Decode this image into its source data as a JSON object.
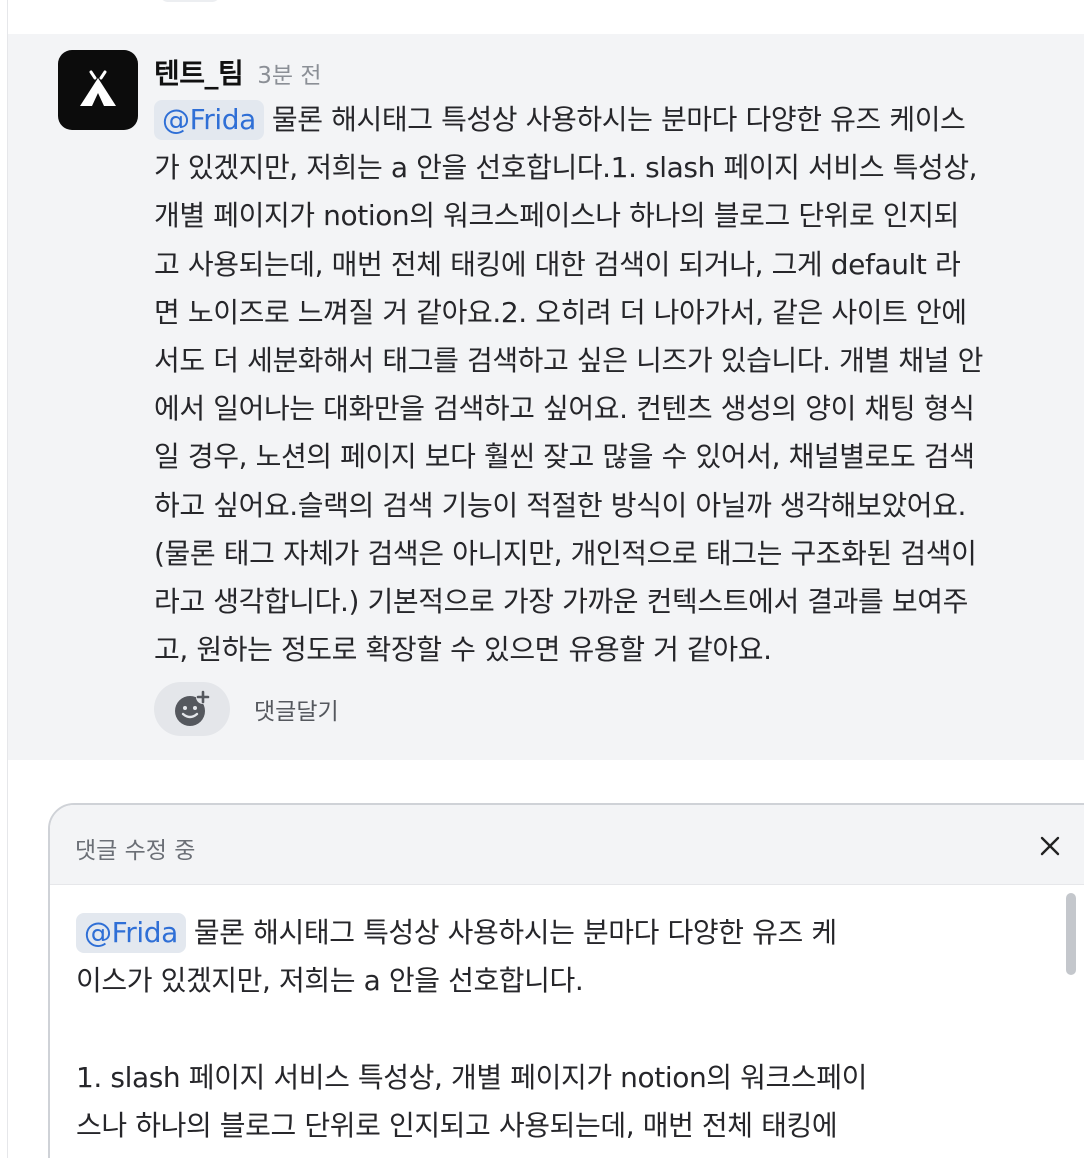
{
  "message": {
    "author": "텐트_팀",
    "time": "3분 전",
    "mention": "@Frida",
    "lines": [
      "물론 해시태그 특성상 사용하시는 분마다 다양한 유즈 케이스",
      "가 있겠지만, 저희는 a 안을 선호합니다.1. slash 페이지 서비스 특성상,",
      "개별 페이지가 notion의 워크스페이스나 하나의 블로그 단위로 인지되",
      "고 사용되는데, 매번 전체 태킹에 대한 검색이 되거나, 그게 default 라",
      "면 노이즈로 느껴질 거 같아요.2. 오히려 더 나아가서, 같은 사이트 안에",
      "서도 더 세분화해서 태그를 검색하고 싶은 니즈가 있습니다. 개별 채널 안",
      "에서 일어나는 대화만을 검색하고 싶어요. 컨텐츠 생성의 양이 채팅 형식",
      "일 경우, 노션의 페이지 보다 훨씬 잦고 많을 수 있어서, 채널별로도 검색",
      "하고 싶어요.슬랙의 검색 기능이 적절한 방식이 아닐까 생각해보았어요.",
      "(물론 태그 자체가 검색은 아니지만, 개인적으로 태그는 구조화된 검색이",
      "라고 생각합니다.) 기본적으로 가장 가까운 컨텍스트에서 결과를 보여주",
      "고, 원하는 정도로 확장할 수 있으면 유용할 거 같아요."
    ],
    "comment_label": "댓글달기"
  },
  "editor": {
    "title": "댓글 수정 중",
    "mention": "@Frida",
    "lines": [
      "물론 해시태그 특성상 사용하시는 분마다 다양한 유즈 케",
      "이스가 있겠지만, 저희는 a 안을 선호합니다.",
      "",
      "1. slash 페이지 서비스 특성상, 개별 페이지가 notion의 워크스페이",
      "스나 하나의 블로그 단위로 인지되고 사용되는데, 매번 전체 태킹에"
    ]
  },
  "icons": {
    "avatar": "tent-icon",
    "reaction": "add-reaction-icon",
    "close": "close-icon"
  },
  "colors": {
    "mention_text": "#2f6fd6",
    "mention_bg": "#e3e8ef",
    "message_bg": "#f3f4f6"
  }
}
